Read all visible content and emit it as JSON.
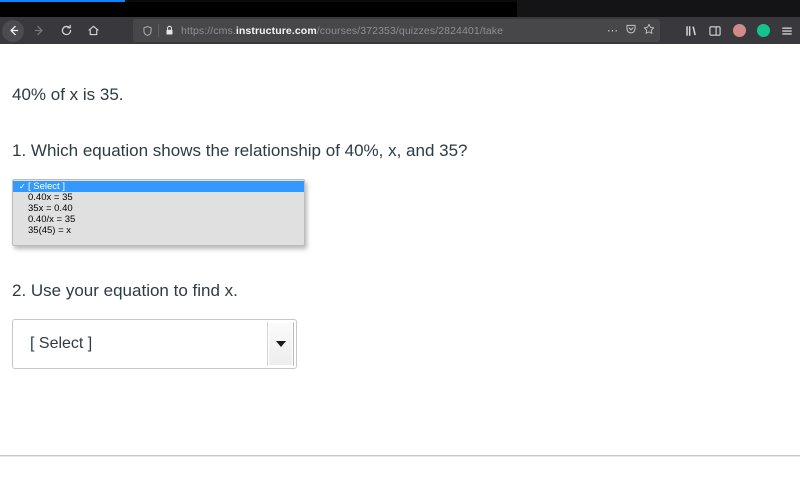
{
  "browser": {
    "nav": {
      "back_label": "Back",
      "forward_label": "Forward",
      "reload_label": "Reload",
      "home_label": "Home"
    },
    "url": {
      "scheme": "https://",
      "subdomain": "cms.",
      "host": "instructure.com",
      "path": "/courses/372353/quizzes/2824401/take",
      "full": "https://cms.instructure.com/courses/372353/quizzes/2824401/take"
    },
    "identity_actions": {
      "page_actions_label": "…",
      "shield_label": "Tracking protection",
      "bookmark_label": "Bookmark this page"
    },
    "toolbar_right": {
      "library_label": "Library",
      "sidebar_label": "Sidebar",
      "profile_label": "Account",
      "sync_label": "Sync",
      "menu_label": "Open application menu"
    }
  },
  "quiz": {
    "stem": "40% of x is 35.",
    "question_1": {
      "text": "1. Which equation shows the relationship of 40%, x, and 35?",
      "dropdown": {
        "open": true,
        "selected_index": 0,
        "check_glyph": "✓",
        "options": [
          "[ Select ]",
          "0.40x = 35",
          "35x = 0.40",
          "0.40/x = 35",
          "35(45) = x"
        ]
      }
    },
    "question_2": {
      "text": "2. Use your equation to find x.",
      "select": {
        "value": "[ Select ]",
        "placeholder": "[ Select ]"
      }
    }
  },
  "colors": {
    "highlight_blue": "#3399ff",
    "chrome_dark": "#38383d",
    "tab_accent": "#0a84ff",
    "text": "#2d3b45",
    "avatar_profile": "#d18a8a",
    "avatar_sync": "#14c38e"
  }
}
